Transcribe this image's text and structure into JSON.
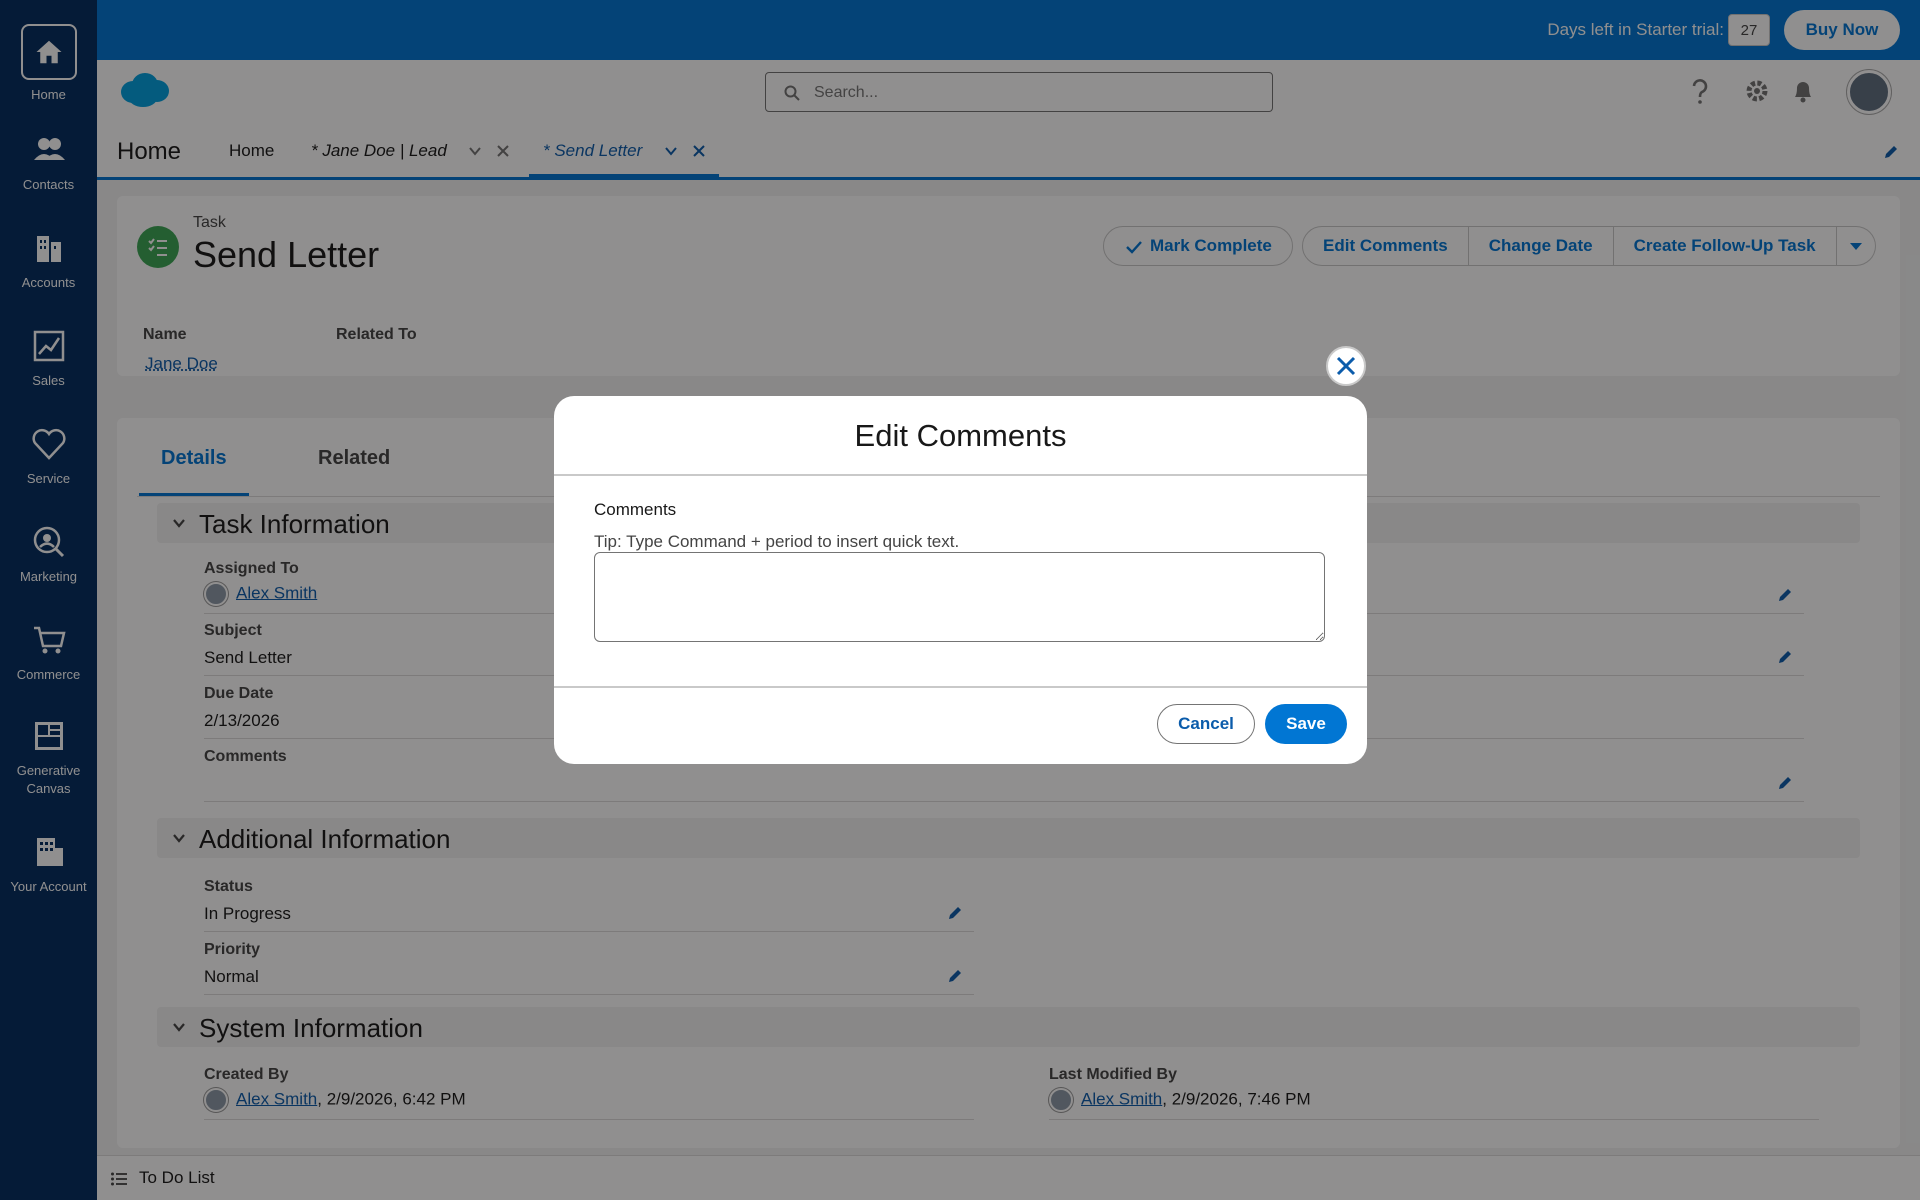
{
  "left_nav": {
    "items": [
      {
        "label": "Home",
        "icon": "home-icon"
      },
      {
        "label": "Contacts",
        "icon": "contacts-icon"
      },
      {
        "label": "Accounts",
        "icon": "accounts-icon"
      },
      {
        "label": "Sales",
        "icon": "sales-icon"
      },
      {
        "label": "Service",
        "icon": "service-icon"
      },
      {
        "label": "Marketing",
        "icon": "marketing-icon"
      },
      {
        "label": "Commerce",
        "icon": "commerce-icon"
      },
      {
        "label": "Generative Canvas",
        "icon": "generative-canvas-icon"
      },
      {
        "label": "Your Account",
        "icon": "your-account-icon"
      }
    ]
  },
  "trial": {
    "text": "Days left in Starter trial:",
    "days": "27",
    "buy_now": "Buy Now"
  },
  "search": {
    "placeholder": "Search..."
  },
  "navbar": {
    "app_name": "Home",
    "tabs": [
      {
        "label": "Home"
      },
      {
        "label": "* Jane Doe | Lead"
      },
      {
        "label": "* Send Letter"
      }
    ]
  },
  "record": {
    "entity": "Task",
    "title": "Send Letter",
    "buttons": {
      "mark_complete": "Mark Complete",
      "edit_comments": "Edit Comments",
      "change_date": "Change Date",
      "create_follow_up": "Create Follow-Up Task"
    },
    "highlights": {
      "name_label": "Name",
      "name_value": "Jane Doe",
      "related_label": "Related To"
    }
  },
  "details": {
    "tabs": [
      "Details",
      "Related"
    ],
    "sections": {
      "task_info": "Task Information",
      "additional_info": "Additional Information",
      "system_info": "System Information"
    },
    "fields": {
      "assigned_to_label": "Assigned To",
      "assigned_to_value": "Alex Smith",
      "subject_label": "Subject",
      "subject_value": "Send Letter",
      "due_date_label": "Due Date",
      "due_date_value": "2/13/2026",
      "comments_label": "Comments",
      "status_label": "Status",
      "status_value": "In Progress",
      "priority_label": "Priority",
      "priority_value": "Normal",
      "created_by_label": "Created By",
      "created_by_user": "Alex Smith",
      "created_by_date": ", 2/9/2026, 6:42 PM",
      "modified_by_label": "Last Modified By",
      "modified_by_user": "Alex Smith",
      "modified_by_date": ", 2/9/2026, 7:46 PM"
    }
  },
  "utility": {
    "todo": "To Do List"
  },
  "modal": {
    "title": "Edit Comments",
    "field_label": "Comments",
    "tip": "Tip: Type Command + period to insert quick text.",
    "value": "",
    "cancel": "Cancel",
    "save": "Save"
  },
  "colors": {
    "brand_blue": "#0176d3",
    "nav_dark": "#032d60",
    "task_green": "#3ba755"
  }
}
